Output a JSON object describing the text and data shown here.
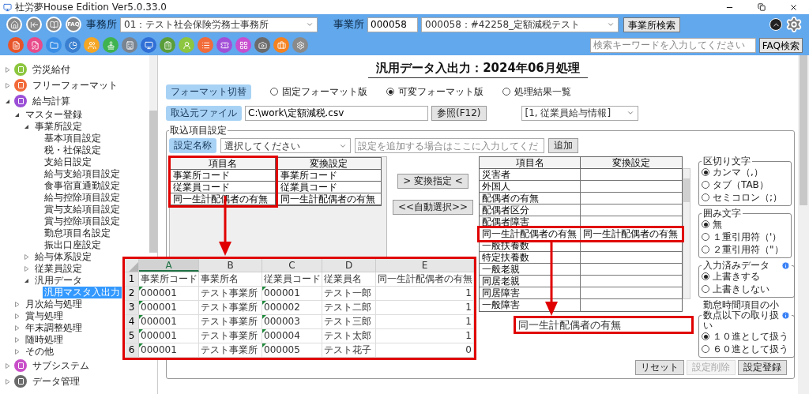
{
  "window": {
    "title": "社労夢House Edition Ver5.0.33.0"
  },
  "toolbar": {
    "nav_icons": [
      {
        "kind": "home"
      },
      {
        "kind": "back"
      },
      {
        "kind": "book"
      },
      {
        "kind": "faq",
        "label": "FAQ"
      }
    ],
    "office_label": "事務所",
    "office_select": {
      "value": "01：テスト社会保険労務士事務所"
    },
    "site_label": "事業所",
    "site_code": {
      "value": "000058"
    },
    "site_select": {
      "value": "000058：#42258_定額減税テスト"
    },
    "site_search_button": "事業所検索",
    "app_icons": [
      {
        "kind": "document",
        "color": "#e8542a"
      },
      {
        "kind": "pen",
        "color": "#e84a8a"
      },
      {
        "kind": "folder",
        "color": "#3a8ee6"
      },
      {
        "kind": "pie",
        "color": "#3a7fd0"
      },
      {
        "kind": "users",
        "color": "#f5a623"
      },
      {
        "kind": "stamp",
        "color": "#3fb34f"
      },
      {
        "kind": "building",
        "color": "#7a8490"
      },
      {
        "kind": "monitor",
        "color": "#2f6fd6"
      },
      {
        "kind": "clipboard",
        "color": "#5a9e3a"
      },
      {
        "kind": "person",
        "color": "#8dc63f"
      },
      {
        "kind": "list",
        "color": "#f26b3a"
      },
      {
        "kind": "ticket",
        "color": "#a24fd8"
      },
      {
        "kind": "grid",
        "color": "#c84fcf"
      },
      {
        "kind": "camera",
        "color": "#6b6b6b"
      },
      {
        "kind": "briefcase",
        "color": "#f5821f"
      },
      {
        "kind": "gear",
        "color": "#8a8a8a"
      }
    ],
    "search": {
      "placeholder": "検索キーワードを入力してください"
    },
    "faq_button": "FAQ検索"
  },
  "sidebar": {
    "items": [
      {
        "label": "労災給付",
        "color": "#8cc63f",
        "expanded": false,
        "selected": false
      },
      {
        "label": "フリーフォーマット",
        "color": "#f26b3a",
        "expanded": false,
        "selected": false
      },
      {
        "label": "給与計算",
        "color": "#9b4fd6",
        "expanded": true,
        "selected": false,
        "children": [
          {
            "label": "マスター登録",
            "expanded": true,
            "selected": false,
            "children": [
              {
                "label": "事業所設定",
                "expanded": true,
                "selected": false,
                "children": [
                  {
                    "label": "基本項目設定",
                    "selected": false
                  },
                  {
                    "label": "税・社保設定",
                    "selected": false
                  },
                  {
                    "label": "支給日設定",
                    "selected": false
                  },
                  {
                    "label": "給与支給項目設定",
                    "selected": false
                  },
                  {
                    "label": "食事宿直通勤設定",
                    "selected": false
                  },
                  {
                    "label": "給与控除項目設定",
                    "selected": false
                  },
                  {
                    "label": "賞与支給項目設定",
                    "selected": false
                  },
                  {
                    "label": "賞与控除項目設定",
                    "selected": false
                  },
                  {
                    "label": "勤怠項目名設定",
                    "selected": false
                  },
                  {
                    "label": "振出口座設定",
                    "selected": false
                  }
                ]
              },
              {
                "label": "給与体系設定",
                "expanded": false,
                "selected": false
              },
              {
                "label": "従業員設定",
                "expanded": false,
                "selected": false
              },
              {
                "label": "汎用データ",
                "expanded": true,
                "selected": false,
                "children": [
                  {
                    "label": "汎用マスタ入出力",
                    "selected": true
                  }
                ]
              }
            ]
          },
          {
            "label": "月次給与処理",
            "expanded": false,
            "selected": false
          },
          {
            "label": "賞与処理",
            "expanded": false,
            "selected": false
          },
          {
            "label": "年末調整処理",
            "expanded": false,
            "selected": false
          },
          {
            "label": "随時処理",
            "expanded": false,
            "selected": false
          },
          {
            "label": "その他",
            "expanded": false,
            "selected": false
          }
        ]
      },
      {
        "label": "サブシステム",
        "color": "#c94fc9",
        "expanded": false,
        "selected": false
      },
      {
        "label": "データ管理",
        "color": "#6b6b6b",
        "expanded": false,
        "selected": false
      }
    ]
  },
  "page_title": "汎用データ入出力：2024年06月処理",
  "format": {
    "button": "フォーマット切替",
    "options": [
      {
        "label": "固定フォーマット版",
        "selected": false
      },
      {
        "label": "可変フォーマット版",
        "selected": true
      },
      {
        "label": "処理結果一覧",
        "selected": false
      }
    ]
  },
  "file": {
    "button": "取込元ファイル",
    "value": "C:\\work\\定額減税.csv",
    "browse_button": "参照(F12)",
    "type_select": "[1, 従業員給与情報]"
  },
  "import_settings": {
    "legend": "取込項目設定",
    "name_button": "設定名称",
    "name_select": "選択してください",
    "new_name": {
      "placeholder": "設定を追加する場合はここに入力してくだ"
    },
    "add_button": "追加",
    "left_table": {
      "columns": [
        {
          "label": "項目名",
          "highlighted": true
        },
        {
          "label": "変換設定",
          "highlighted": false
        }
      ],
      "rows": [
        [
          "事業所コード",
          "事業所コード"
        ],
        [
          "従業員コード",
          "従業員コード"
        ],
        [
          "同一生計配偶者の有無",
          "同一生計配偶者の有無"
        ]
      ]
    },
    "map_button": "> 変換指定 <",
    "auto_button": "<<自動選択>>",
    "right_table": {
      "columns": [
        "項目名",
        "変換設定"
      ],
      "rows": [
        {
          "name": "災害者",
          "highlighted": false
        },
        {
          "name": "外国人",
          "highlighted": false
        },
        {
          "name": "配偶者の有無",
          "highlighted": false
        },
        {
          "name": "配偶者区分",
          "highlighted": false
        },
        {
          "name": "配偶者障害",
          "highlighted": false
        },
        {
          "name": "同一生計配偶者の有無",
          "conversion": "同一生計配偶者の有無",
          "highlighted": true
        },
        {
          "name": "一般扶養数",
          "highlighted": false
        },
        {
          "name": "特定扶養数",
          "highlighted": false
        },
        {
          "name": "一般老親",
          "highlighted": false
        },
        {
          "name": "同居老親",
          "highlighted": false
        },
        {
          "name": "同居障害",
          "highlighted": false
        },
        {
          "name": "一般障害",
          "highlighted": false
        }
      ]
    },
    "option_groups": [
      {
        "title": "区切り文字",
        "info": false,
        "options": [
          {
            "label": "カンマ（,）",
            "selected": true
          },
          {
            "label": "タブ（TAB）",
            "selected": false
          },
          {
            "label": "セミコロン（;）",
            "selected": false
          }
        ]
      },
      {
        "title": "囲み文字",
        "info": false,
        "options": [
          {
            "label": "無",
            "selected": true
          },
          {
            "label": "１重引用符（'）",
            "selected": false
          },
          {
            "label": "２重引用符（\"）",
            "selected": false
          }
        ]
      },
      {
        "title": "入力済みデータ",
        "info": true,
        "options": [
          {
            "label": "上書きする",
            "selected": true
          },
          {
            "label": "上書きしない",
            "selected": false
          }
        ]
      },
      {
        "title": "勤怠時間項目の小数点以下の取り扱い",
        "info": true,
        "options": [
          {
            "label": "１０進として扱う",
            "selected": true
          },
          {
            "label": "６０進として扱う",
            "selected": false
          }
        ]
      }
    ],
    "buttons": [
      {
        "label": "リセット",
        "disabled": false
      },
      {
        "label": "設定削除",
        "disabled": true
      },
      {
        "label": "設定登録",
        "disabled": false
      }
    ]
  },
  "spreadsheet": {
    "columns": [
      {
        "label": "A",
        "selected": true,
        "flagged": true,
        "numeric": false
      },
      {
        "label": "B",
        "selected": false,
        "flagged": false,
        "numeric": false
      },
      {
        "label": "C",
        "selected": false,
        "flagged": true,
        "numeric": false
      },
      {
        "label": "D",
        "selected": false,
        "flagged": false,
        "numeric": false
      },
      {
        "label": "E",
        "selected": false,
        "flagged": false,
        "numeric": true
      }
    ],
    "rows": [
      {
        "number": "1",
        "kind": "header",
        "cells": [
          "事業所コード",
          "事業所名",
          "従業員コード",
          "従業員名",
          "同一生計配偶者の有無"
        ]
      },
      {
        "number": "2",
        "kind": "data",
        "cells": [
          "000001",
          "テスト事業所",
          "000001",
          "テスト一郎",
          "1"
        ]
      },
      {
        "number": "3",
        "kind": "data",
        "cells": [
          "000001",
          "テスト事業所",
          "000002",
          "テスト二郎",
          "1"
        ]
      },
      {
        "number": "4",
        "kind": "data",
        "cells": [
          "000001",
          "テスト事業所",
          "000003",
          "テスト三郎",
          "1"
        ]
      },
      {
        "number": "5",
        "kind": "data",
        "cells": [
          "000001",
          "テスト事業所",
          "000004",
          "テスト太郎",
          "1"
        ]
      },
      {
        "number": "6",
        "kind": "data",
        "cells": [
          "000001",
          "テスト事業所",
          "000005",
          "テスト花子",
          "0"
        ]
      }
    ]
  },
  "callout": {
    "text": "同一生計配偶者の有無"
  }
}
